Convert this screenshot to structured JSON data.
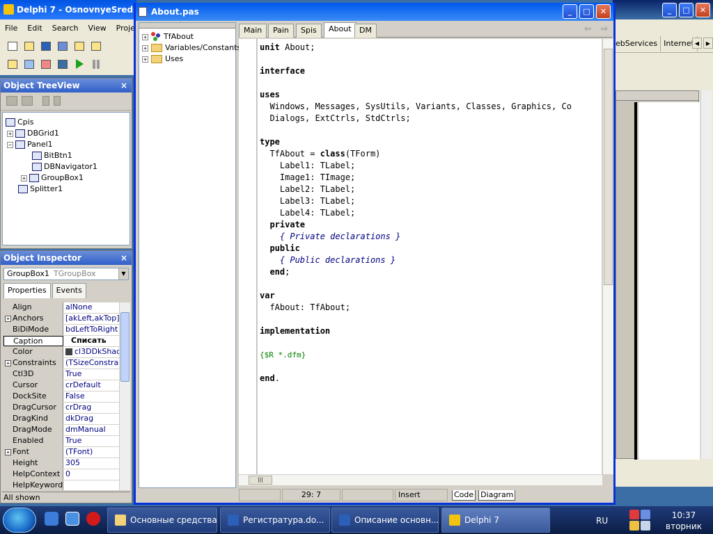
{
  "main_window": {
    "title": "Delphi 7 - OsnovnyeSredstva",
    "menu": [
      "File",
      "Edit",
      "Search",
      "View",
      "Projec"
    ]
  },
  "background_window": {
    "tabs": [
      "ebServices",
      "Internet"
    ]
  },
  "tree_view": {
    "title": "Object TreeView",
    "close": "×",
    "nodes": [
      {
        "label": "Cpis"
      },
      {
        "label": "DBGrid1"
      },
      {
        "label": "Panel1"
      },
      {
        "label": "BitBtn1"
      },
      {
        "label": "DBNavigator1"
      },
      {
        "label": "GroupBox1"
      },
      {
        "label": "Splitter1"
      }
    ]
  },
  "inspector": {
    "title": "Object Inspector",
    "close": "×",
    "selected_object": "GroupBox1",
    "selected_type": "TGroupBox",
    "tabs": [
      "Properties",
      "Events"
    ],
    "properties": [
      {
        "name": "Align",
        "value": "alNone"
      },
      {
        "name": "Anchors",
        "value": "[akLeft,akTop]",
        "expandable": true
      },
      {
        "name": "BiDiMode",
        "value": "bdLeftToRight"
      },
      {
        "name": "Caption",
        "value": "Списать",
        "selected": true
      },
      {
        "name": "Color",
        "value": "cl3DDkShac"
      },
      {
        "name": "Constraints",
        "value": "(TSizeConstrain",
        "expandable": true
      },
      {
        "name": "Ctl3D",
        "value": "True"
      },
      {
        "name": "Cursor",
        "value": "crDefault"
      },
      {
        "name": "DockSite",
        "value": "False"
      },
      {
        "name": "DragCursor",
        "value": "crDrag"
      },
      {
        "name": "DragKind",
        "value": "dkDrag"
      },
      {
        "name": "DragMode",
        "value": "dmManual"
      },
      {
        "name": "Enabled",
        "value": "True"
      },
      {
        "name": "Font",
        "value": "(TFont)",
        "expandable": true
      },
      {
        "name": "Height",
        "value": "305"
      },
      {
        "name": "HelpContext",
        "value": "0"
      },
      {
        "name": "HelpKeyword",
        "value": ""
      }
    ],
    "status": "All shown"
  },
  "editor": {
    "title": "About.pas",
    "explorer": [
      {
        "label": "TfAbout"
      },
      {
        "label": "Variables/Constants"
      },
      {
        "label": "Uses"
      }
    ],
    "tabs": [
      "Main",
      "Pain",
      "Spis",
      "About",
      "DM"
    ],
    "active_tab": "About",
    "code_lines": [
      [
        {
          "t": "unit",
          "s": "kw"
        },
        {
          "t": " About;"
        }
      ],
      [],
      [
        {
          "t": "interface",
          "s": "kw"
        }
      ],
      [],
      [
        {
          "t": "uses",
          "s": "kw"
        }
      ],
      [
        {
          "t": "  Windows, Messages, SysUtils, Variants, Classes, Graphics, Co"
        }
      ],
      [
        {
          "t": "  Dialogs, ExtCtrls, StdCtrls;"
        }
      ],
      [],
      [
        {
          "t": "type",
          "s": "kw"
        }
      ],
      [
        {
          "t": "  TfAbout = "
        },
        {
          "t": "class",
          "s": "kw"
        },
        {
          "t": "(TForm)"
        }
      ],
      [
        {
          "t": "    Label1: TLabel;"
        }
      ],
      [
        {
          "t": "    Image1: TImage;"
        }
      ],
      [
        {
          "t": "    Label2: TLabel;"
        }
      ],
      [
        {
          "t": "    Label3: TLabel;"
        }
      ],
      [
        {
          "t": "    Label4: TLabel;"
        }
      ],
      [
        {
          "t": "  "
        },
        {
          "t": "private",
          "s": "kw"
        }
      ],
      [
        {
          "t": "    "
        },
        {
          "t": "{ Private declarations }",
          "s": "cm"
        }
      ],
      [
        {
          "t": "  "
        },
        {
          "t": "public",
          "s": "kw"
        }
      ],
      [
        {
          "t": "    "
        },
        {
          "t": "{ Public declarations }",
          "s": "cm"
        }
      ],
      [
        {
          "t": "  "
        },
        {
          "t": "end",
          "s": "kw"
        },
        {
          "t": ";"
        }
      ],
      [],
      [
        {
          "t": "var",
          "s": "kw"
        }
      ],
      [
        {
          "t": "  fAbout: TfAbout;"
        }
      ],
      [],
      [
        {
          "t": "implementation",
          "s": "kw"
        }
      ],
      [],
      [
        {
          "t": "{$R *.dfm}",
          "s": "dir"
        }
      ],
      [],
      [
        {
          "t": "end",
          "s": "kw"
        },
        {
          "t": "."
        }
      ]
    ],
    "status": {
      "cursor_pos": "29:  7",
      "mode": "Insert",
      "view_tabs": [
        "Code",
        "Diagram"
      ]
    }
  },
  "taskbar": {
    "items": [
      {
        "label": "Основные средства",
        "color": "#f3d37a"
      },
      {
        "label": "Регистратура.do...",
        "color": "#2b5fb8"
      },
      {
        "label": "Описание основн...",
        "color": "#2b5fb8"
      },
      {
        "label": "Delphi 7",
        "color": "#f2c40f",
        "active": true
      }
    ],
    "language": "RU",
    "time": "10:37",
    "day": "вторник"
  },
  "colors": {
    "titlebar": "#0054e3",
    "keyword": "#000000",
    "comment": "#000080",
    "directive": "#008000",
    "property_value": "#000080"
  }
}
